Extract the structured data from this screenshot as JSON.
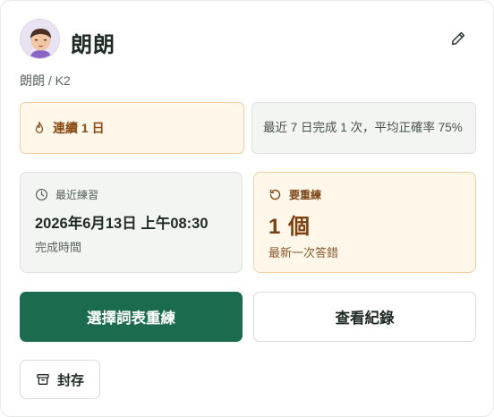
{
  "profile": {
    "name": "朗朗",
    "breadcrumb": "朗朗 / K2"
  },
  "streak": {
    "label": "連續 1 日"
  },
  "summary": {
    "text": "最近 7 日完成 1 次，平均正確率 75%"
  },
  "recent_practice": {
    "label": "最近練習",
    "value": "2026年6月13日 上午08:30",
    "sub": "完成時間"
  },
  "retrain": {
    "label": "要重練",
    "value": "1 個",
    "sub": "最新一次答錯"
  },
  "actions": {
    "primary": "選擇詞表重練",
    "secondary": "查看紀錄",
    "archive": "封存"
  },
  "icons": {
    "edit": "pencil-icon",
    "streak": "flame-icon",
    "recent": "clock-icon",
    "retrain": "refresh-icon",
    "archive": "archive-box-icon"
  },
  "colors": {
    "primary": "#1b6b4f",
    "warm_bg": "#fff7ea",
    "warm_border": "#efcf9e",
    "neutral_bg": "#f3f5f3"
  }
}
